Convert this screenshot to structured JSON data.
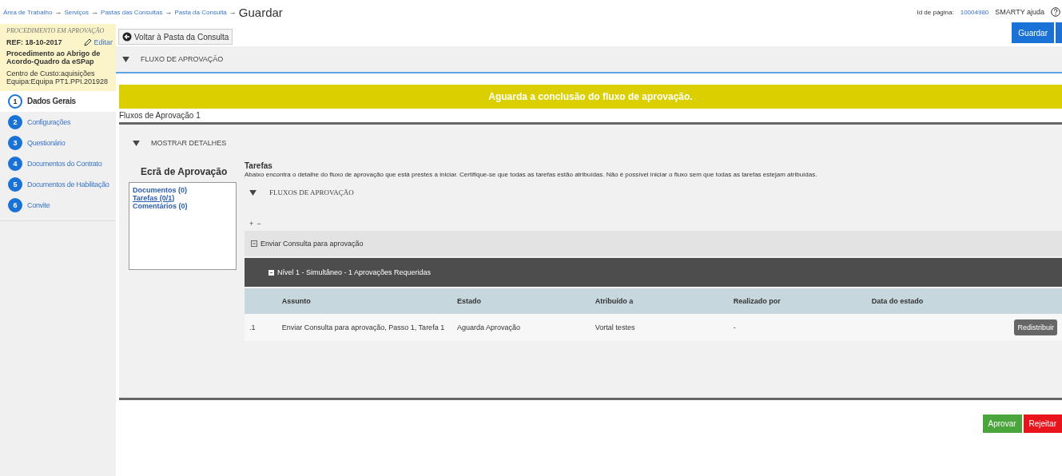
{
  "breadcrumb": {
    "links": [
      "Área de Trabalho",
      "Serviços",
      "Pastas das Consultas",
      "Pasta da Consulta"
    ],
    "separator": "→",
    "current": "Guardar"
  },
  "header": {
    "page_id_label": "Id de página:",
    "page_id": "10004980",
    "help": "SMARTY ajuda"
  },
  "toolbar": {
    "buttons": [
      {
        "label": "Guardar"
      },
      {
        "kind": "cut"
      }
    ]
  },
  "summary": {
    "status": "PROCEDIMENTO EM APROVAÇÃO",
    "ref": "REF: 18-10-2017",
    "edit": "Editar",
    "procedure": "Procedimento ao Abrigo de Acordo-Quadro da eSPap",
    "cost_center": "Centro de Custo:aquisições",
    "team": "Equipa:Equipa PT1.PPI.201928"
  },
  "steps": [
    {
      "number": "1",
      "label": "Dados Gerais",
      "selected": true
    },
    {
      "number": "2",
      "label": "Configurações",
      "selected": false
    },
    {
      "number": "3",
      "label": "Questionário",
      "selected": false
    },
    {
      "number": "4",
      "label": "Documentos do Contrato",
      "selected": false
    },
    {
      "number": "5",
      "label": "Documentos de Habilitação",
      "selected": false
    },
    {
      "number": "6",
      "label": "Convite",
      "selected": false
    }
  ],
  "back_button": "Voltar à Pasta da Consulta",
  "section_title": "FLUXO DE APROVAÇÃO",
  "banner": "Aguarda a conclusão do fluxo de aprovação.",
  "flow_tab": "Fluxos de Aprovação 1",
  "details_toggle": "MOSTRAR DETALHES",
  "approval_screen": {
    "title": "Ecrã de Aprovação",
    "links": [
      {
        "label": "Documentos (0)",
        "selected": false
      },
      {
        "label": "Tarefas (0/1)",
        "selected": true
      },
      {
        "label": "Comentários (0)",
        "selected": false
      }
    ]
  },
  "tasks": {
    "title": "Tarefas",
    "description": "Abaixo encontra o detalhe do fluxo de aprovação que está prestes a iniciar. Certifique-se que todas as tarefas estão atribuídas. Não é possível iniciar o fluxo sem que todas as tarefas estejam atribuídas.",
    "flows_toggle": "FLUXOS DE APROVAÇÃO",
    "expand_all": "+",
    "collapse_all": "−",
    "group": "Enviar Consulta para aprovação",
    "level": "Nível 1 - Simultâneo - 1 Aprovações Requeridas",
    "table": {
      "columns": [
        "",
        "Assunto",
        "Estado",
        "Atribuído a",
        "Realizado por",
        "Data do estado",
        ""
      ],
      "rows": [
        {
          "cells": [
            ".1",
            "Enviar Consulta para aprovação, Passo 1, Tarefa 1",
            "Aguarda Aprovação",
            "Vortal testes",
            "-",
            ""
          ],
          "action": "Redistribuir"
        }
      ]
    }
  },
  "actions": [
    {
      "label": "Aprovar",
      "kind": "approve"
    },
    {
      "label": "Rejeitar",
      "kind": "reject"
    }
  ]
}
